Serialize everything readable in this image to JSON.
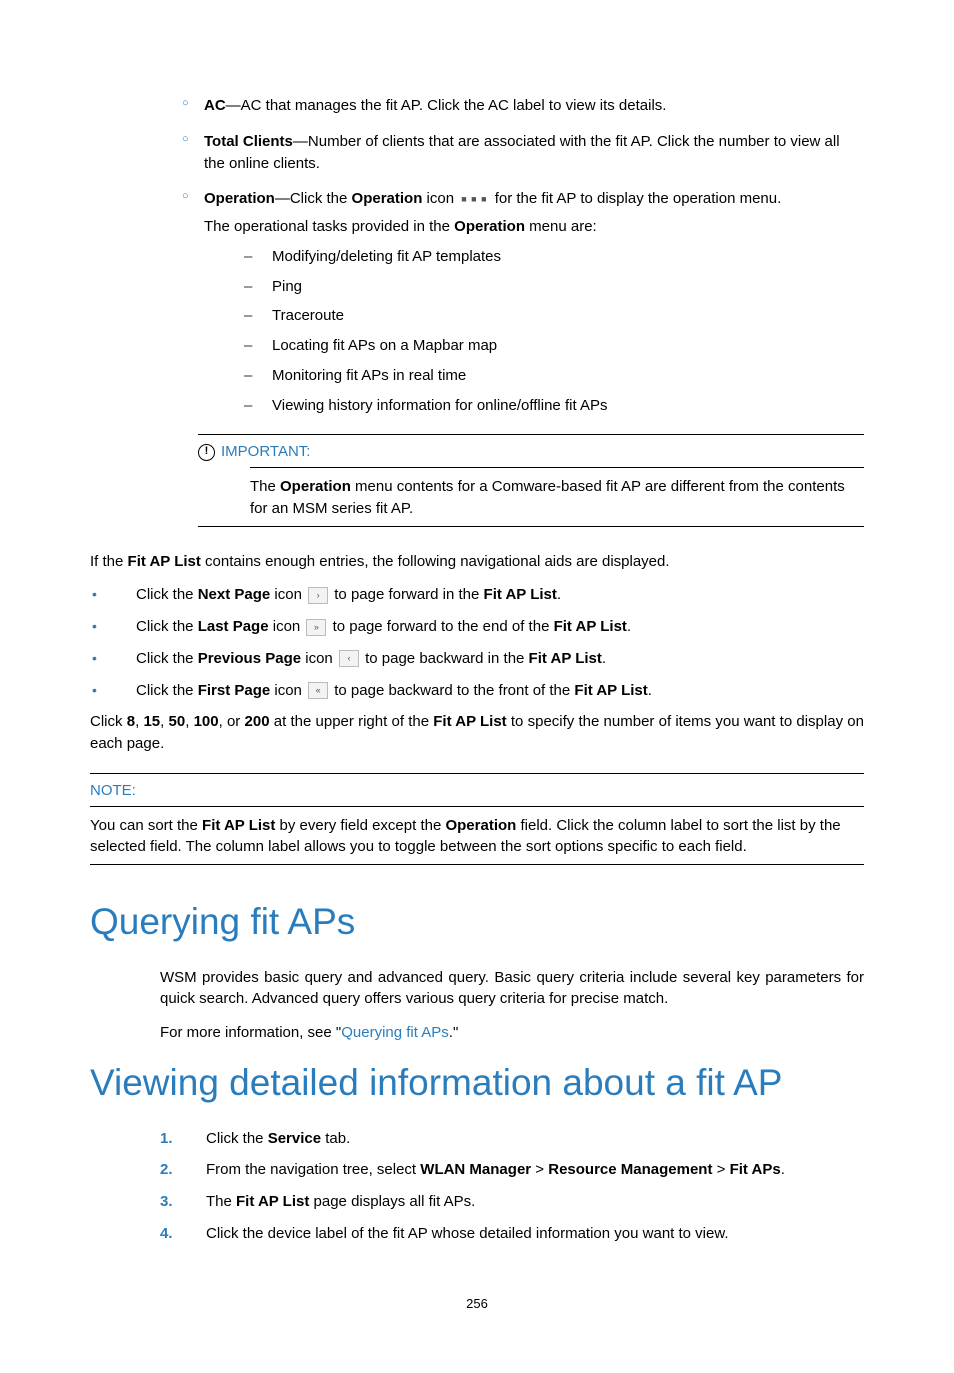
{
  "circ_items": {
    "ac_label": "AC",
    "ac_rest": "—AC that manages the fit AP. Click the AC label to view its details.",
    "tc_label": "Total Clients",
    "tc_rest": "—Number of clients that are associated with the fit AP. Click the number to view all the online clients.",
    "op_label": "Operation",
    "op_mid1": "—Click the ",
    "op_bold2": "Operation",
    "op_mid2": " icon ",
    "op_rest": " for the fit AP to display the operation menu.",
    "op_sub_intro_a": "The operational tasks provided in the ",
    "op_sub_intro_b": "Operation",
    "op_sub_intro_c": " menu are:"
  },
  "dash_items": [
    "Modifying/deleting fit AP templates",
    "Ping",
    "Traceroute",
    "Locating fit APs on a Mapbar map",
    "Monitoring fit APs in real time",
    "Viewing history information for online/offline fit APs"
  ],
  "important": {
    "heading": "IMPORTANT:",
    "body_a": "The ",
    "body_b": "Operation",
    "body_c": " menu contents for a Comware-based fit AP are different from the contents for an MSM series fit AP."
  },
  "nav_intro_a": "If the ",
  "nav_intro_b": "Fit AP List",
  "nav_intro_c": " contains enough entries, the following navigational aids are displayed.",
  "nav": {
    "next": {
      "pre": "Click the ",
      "label": "Next Page",
      "mid": " icon ",
      "glyph": "›",
      "post_a": " to page forward in the ",
      "post_b": "Fit AP List",
      "post_c": "."
    },
    "last": {
      "pre": "Click the ",
      "label": "Last Page",
      "mid": " icon ",
      "glyph": "»",
      "post_a": " to page forward to the end of the ",
      "post_b": "Fit AP List",
      "post_c": "."
    },
    "prev": {
      "pre": "Click the ",
      "label": "Previous Page",
      "mid": " icon ",
      "glyph": "‹",
      "post_a": " to page backward in the ",
      "post_b": "Fit AP List",
      "post_c": "."
    },
    "first": {
      "pre": "Click the ",
      "label": "First Page",
      "mid": " icon ",
      "glyph": "«",
      "post_a": " to page backward to the front of the ",
      "post_b": "Fit AP List",
      "post_c": "."
    }
  },
  "pagesize": {
    "a": "Click ",
    "n1": "8",
    "c1": ", ",
    "n2": "15",
    "c2": ", ",
    "n3": "50",
    "c3": ", ",
    "n4": "100",
    "c4": ", or ",
    "n5": "200",
    "mid": " at the upper right of the ",
    "list": "Fit AP List",
    "rest": " to specify the number of items you want to display on each page."
  },
  "note": {
    "heading": "NOTE:",
    "a": "You can sort the ",
    "b": "Fit AP List",
    "c": " by every field except the ",
    "d": "Operation",
    "e": " field. Click the column label to sort the list by the selected field. The column label allows you to toggle between the sort options specific to each field."
  },
  "h1_query": "Querying fit APs",
  "query_p1": "WSM provides basic query and advanced query. Basic query criteria include several key parameters for quick search. Advanced query offers various query criteria for precise match.",
  "query_p2_a": "For more information, see \"",
  "query_p2_link": "Querying fit APs",
  "query_p2_b": ".\"",
  "h1_view": "Viewing detailed information about a fit AP",
  "steps": {
    "s1": {
      "num": "1.",
      "a": "Click the ",
      "b": "Service",
      "c": " tab."
    },
    "s2": {
      "num": "2.",
      "a": "From the navigation tree, select ",
      "b": "WLAN Manager",
      "gt1": " > ",
      "c": "Resource Management",
      "gt2": " > ",
      "d": "Fit APs",
      "e": "."
    },
    "s3": {
      "num": "3.",
      "a": "The ",
      "b": "Fit AP List",
      "c": " page displays all fit APs."
    },
    "s4": {
      "num": "4.",
      "a": "Click the device label of the fit AP whose detailed information you want to view."
    }
  },
  "page_number": "256"
}
